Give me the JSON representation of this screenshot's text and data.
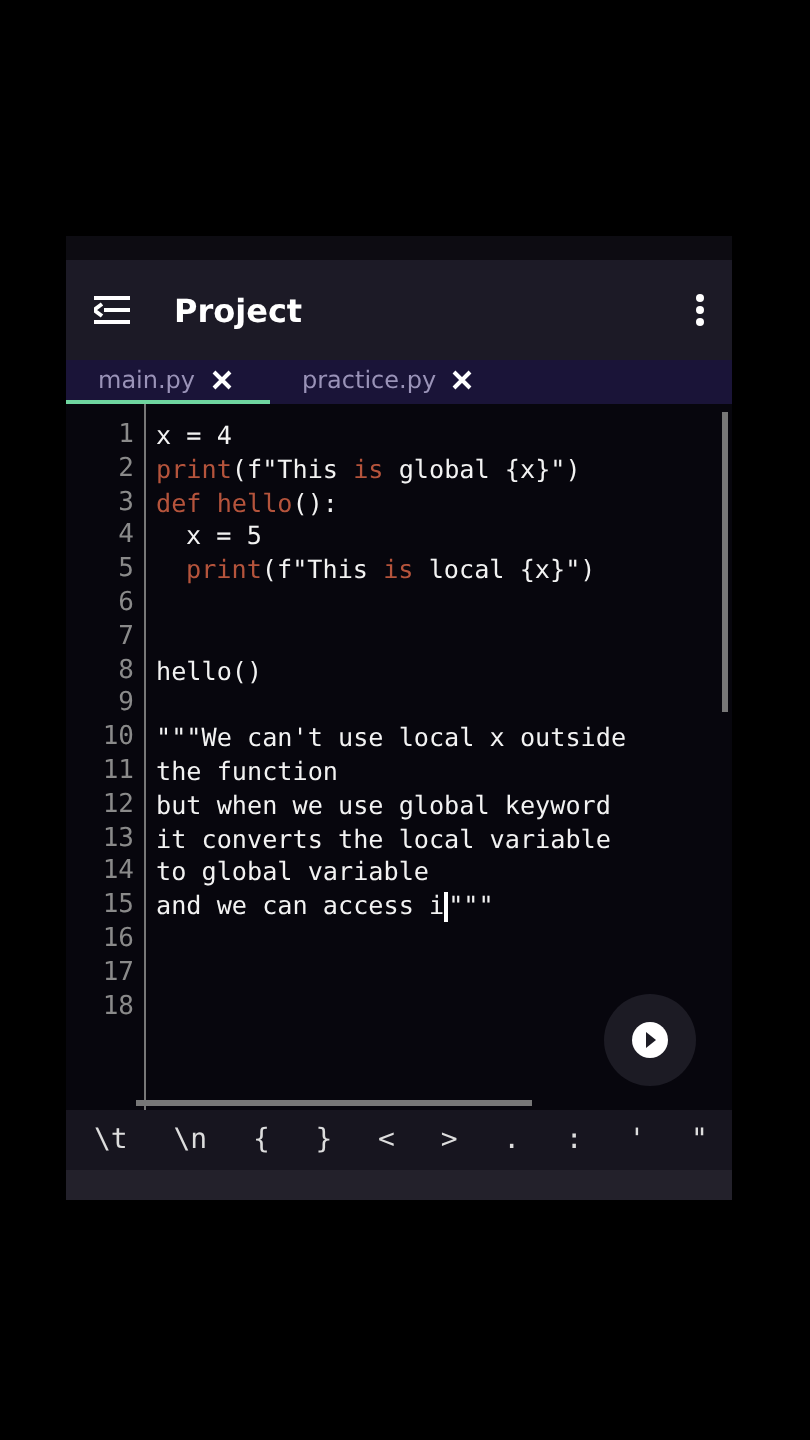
{
  "toolbar": {
    "title": "Project"
  },
  "tabs": [
    {
      "label": "main.py",
      "selected": true
    },
    {
      "label": "practice.py",
      "selected": false
    }
  ],
  "editor": {
    "lines": [
      {
        "number": "1",
        "tokens": [
          {
            "kind": "plain",
            "text": "x = 4"
          }
        ]
      },
      {
        "number": "2",
        "tokens": [
          {
            "kind": "keyword",
            "text": "print"
          },
          {
            "kind": "plain",
            "text": "(f\"This "
          },
          {
            "kind": "keyword",
            "text": "is"
          },
          {
            "kind": "plain",
            "text": " global {x}\")"
          }
        ]
      },
      {
        "number": "3",
        "tokens": [
          {
            "kind": "keyword",
            "text": "def hello"
          },
          {
            "kind": "plain",
            "text": "():"
          }
        ]
      },
      {
        "number": "4",
        "indented": true,
        "tokens": [
          {
            "kind": "plain",
            "text": "x = 5"
          }
        ]
      },
      {
        "number": "5",
        "indented": true,
        "tokens": [
          {
            "kind": "keyword",
            "text": "print"
          },
          {
            "kind": "plain",
            "text": "(f\"This "
          },
          {
            "kind": "keyword",
            "text": "is"
          },
          {
            "kind": "plain",
            "text": " local {x}\")"
          }
        ]
      },
      {
        "number": "6"
      },
      {
        "number": "7"
      },
      {
        "number": "8",
        "tokens": [
          {
            "kind": "plain",
            "text": "hello()"
          }
        ]
      },
      {
        "number": "9"
      },
      {
        "number": "10",
        "tokens": [
          {
            "kind": "plain",
            "text": "\"\"\"We can't use local x outside"
          }
        ]
      },
      {
        "number": "11",
        "tokens": [
          {
            "kind": "plain",
            "text": "the function"
          }
        ]
      },
      {
        "number": "12",
        "tokens": [
          {
            "kind": "plain",
            "text": "but when we use global keyword"
          }
        ]
      },
      {
        "number": "13",
        "tokens": [
          {
            "kind": "plain",
            "text": "it converts the local variable"
          }
        ]
      },
      {
        "number": "14",
        "tokens": [
          {
            "kind": "plain",
            "text": "to global variable"
          }
        ]
      },
      {
        "number": "15",
        "tokens": [
          {
            "kind": "plain",
            "text": "and we can access i"
          },
          {
            "kind": "cursor"
          },
          {
            "kind": "plain",
            "text": "\"\"\""
          }
        ]
      },
      {
        "number": "16"
      },
      {
        "number": "17"
      },
      {
        "number": "18"
      }
    ]
  },
  "symbol_keys": [
    "\\t",
    "\\n",
    "{",
    "}",
    "<",
    ">",
    ".",
    ":",
    "'",
    "\""
  ]
}
